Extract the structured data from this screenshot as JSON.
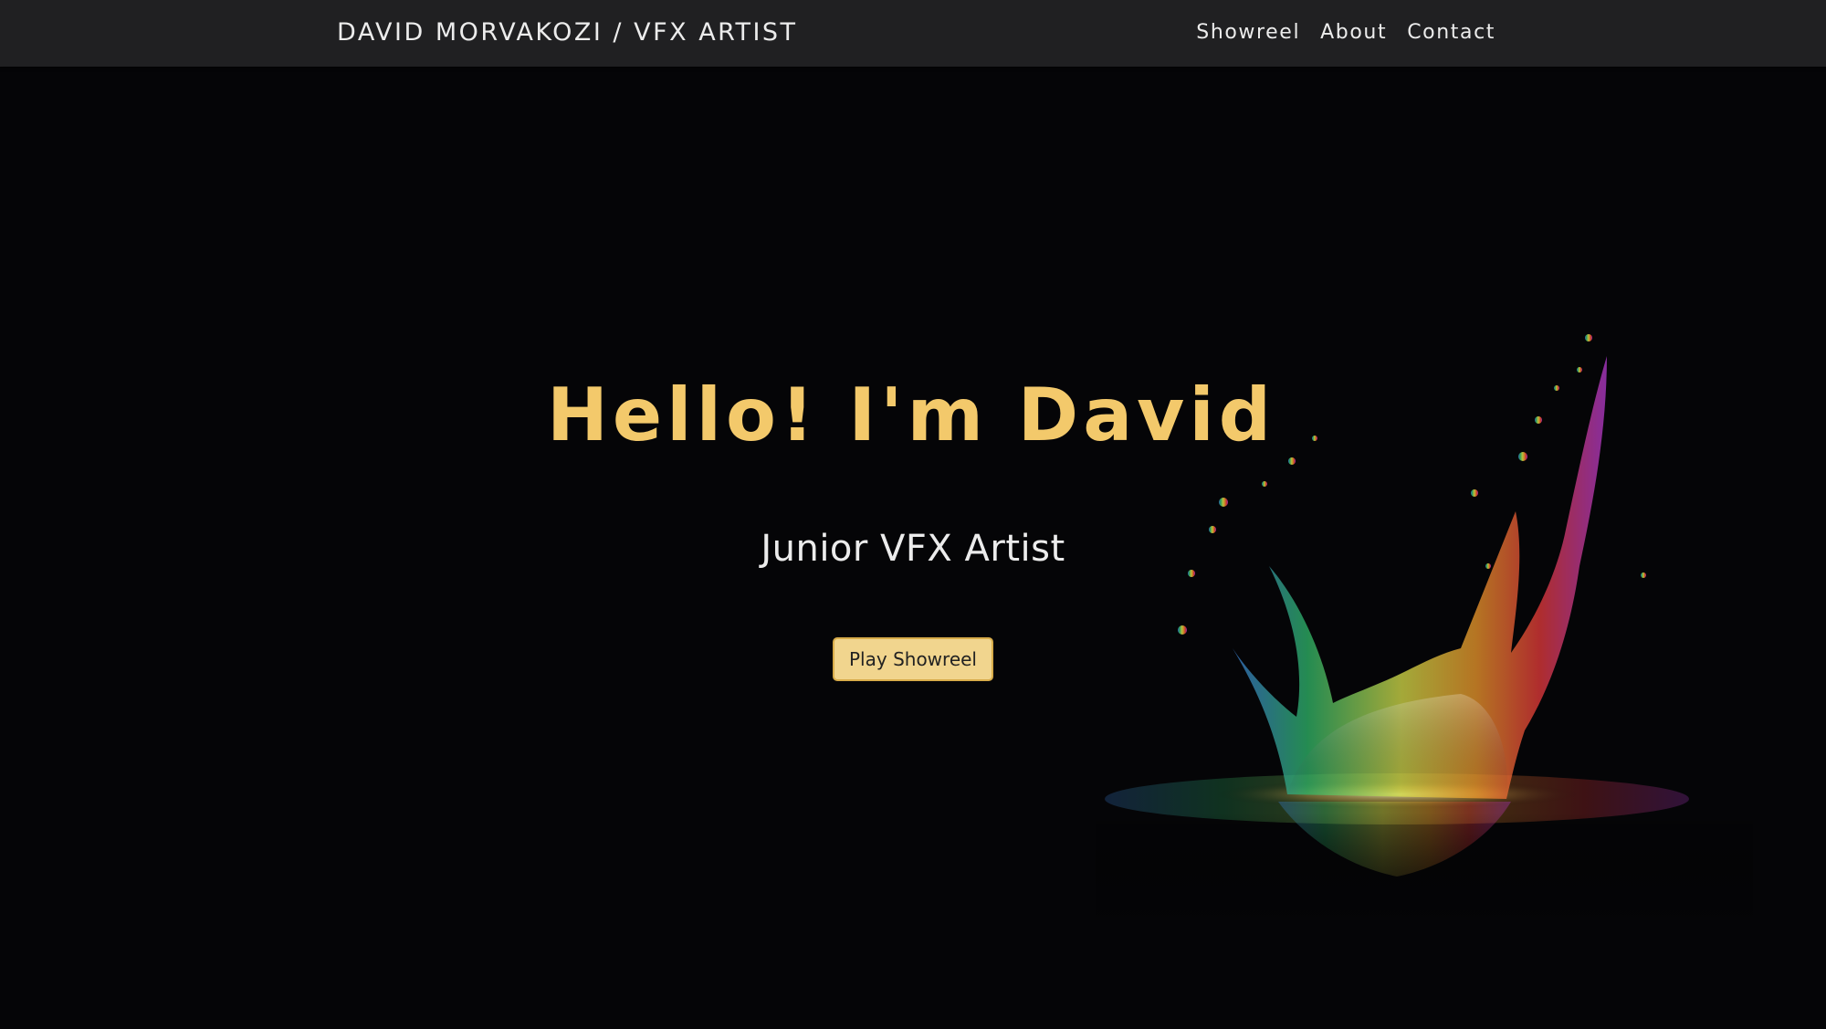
{
  "navbar": {
    "brand": "DAVID MORVAKOZI / VFX ARTIST",
    "links": [
      {
        "label": "Showreel"
      },
      {
        "label": "About"
      },
      {
        "label": "Contact"
      }
    ]
  },
  "hero": {
    "title": "Hello! I'm David",
    "subtitle": "Junior VFX Artist",
    "button_label": "Play Showreel"
  },
  "colors": {
    "background": "#050507",
    "navbar_bg": "#202022",
    "title_accent": "#f3c96b",
    "button_bg": "#f1d58e",
    "button_border": "#d8ac4a"
  }
}
